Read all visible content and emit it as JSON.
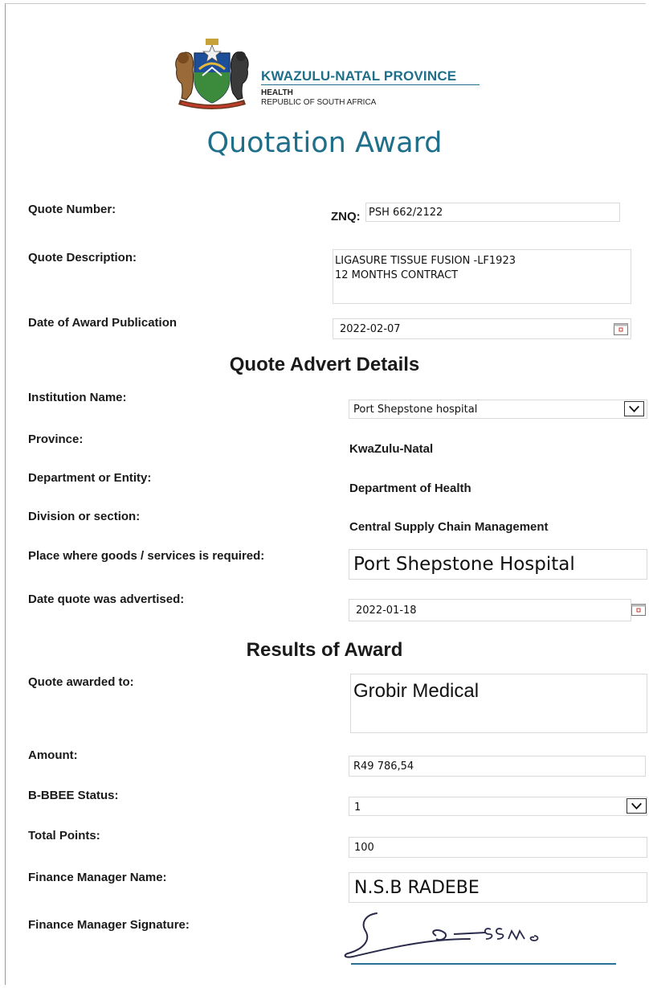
{
  "header": {
    "org_name": "KWAZULU-NATAL PROVINCE",
    "dept": "HEALTH",
    "country": "REPUBLIC OF SOUTH AFRICA",
    "title": "Quotation Award"
  },
  "quote": {
    "number_label": "Quote Number:",
    "number_prefix": "ZNQ:",
    "number_value": "PSH 662/2122",
    "description_label": "Quote Description:",
    "description_line1": "LIGASURE TISSUE FUSION -LF1923",
    "description_line2": "12 MONTHS CONTRACT",
    "award_date_label": "Date of Award Publication",
    "award_date_value": "2022-02-07"
  },
  "advert": {
    "heading": "Quote Advert Details",
    "institution_label": "Institution Name:",
    "institution_value": "Port Shepstone  hospital",
    "province_label": "Province:",
    "province_value": "KwaZulu-Natal",
    "department_label": "Department or Entity:",
    "department_value": "Department of Health",
    "division_label": "Division or section:",
    "division_value": "Central Supply Chain Management",
    "place_label": "Place where goods /  services is required:",
    "place_value": "Port Shepstone Hospital",
    "advertised_label": "Date quote was advertised:",
    "advertised_value": "2022-01-18"
  },
  "results": {
    "heading": "Results of Award",
    "awarded_label": "Quote awarded to:",
    "awarded_value": "Grobir Medical",
    "amount_label": "Amount:",
    "amount_value": "R49 786,54",
    "bbbee_label": "B-BBEE Status:",
    "bbbee_value": "1",
    "points_label": "Total Points:",
    "points_value": "100",
    "fm_name_label": "Finance Manager Name:",
    "fm_name_value": "N.S.B RADEBE",
    "fm_signature_label": "Finance Manager Signature:"
  },
  "colors": {
    "title_teal": "#1f6f8b",
    "signature_ink": "#2a2a4a",
    "signature_rule": "#2a6f95"
  }
}
